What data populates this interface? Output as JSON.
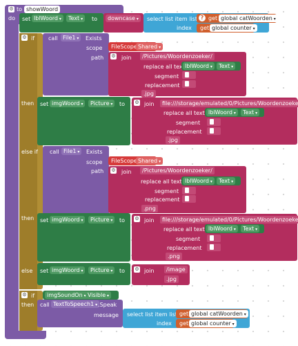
{
  "proc": {
    "to": "to",
    "name": "showWoord",
    "do": "do"
  },
  "set1": {
    "set": "set",
    "comp": "lblWoord",
    "prop": "Text",
    "to": "to",
    "fn": "downcase",
    "select": "select list item  list",
    "get": "get",
    "var1": "global catWoorden",
    "index": "index",
    "var2": "global counter"
  },
  "if1": {
    "if": "if",
    "call": "call",
    "file": "File1",
    "exists": "Exists",
    "scope": "scope",
    "scopeVal": "FileScope",
    "shared": "Shared",
    "path": "path",
    "join": "join",
    "pathStr": "/Pictures/Woordenzoeker/",
    "replace": "replace all text",
    "comp": "lblWoord",
    "prop": "Text",
    "segment": "segment",
    "replacement": "replacement",
    "ext": ".jpg"
  },
  "then1": {
    "then": "then",
    "set": "set",
    "comp": "imgWoord",
    "prop": "Picture",
    "to": "to",
    "join": "join",
    "fileStr": "file:///storage/emulated/0/Pictures/Woordenzoeker/",
    "replace": "replace all text",
    "comp2": "lblWoord",
    "prop2": "Text",
    "segment": "segment",
    "replacement": "replacement",
    "ext": ".jpg"
  },
  "elif": {
    "elseif": "else if",
    "call": "call",
    "file": "File1",
    "exists": "Exists",
    "scope": "scope",
    "scopeVal": "FileScope",
    "shared": "Shared",
    "path": "path",
    "join": "join",
    "pathStr": "/Pictures/Woordenzoeker/",
    "replace": "replace all text",
    "comp": "lblWoord",
    "prop": "Text",
    "segment": "segment",
    "replacement": "replacement",
    "ext": ".png"
  },
  "then2": {
    "then": "then",
    "set": "set",
    "comp": "imgWoord",
    "prop": "Picture",
    "to": "to",
    "join": "join",
    "fileStr": "file:///storage/emulated/0/Pictures/Woordenzoeker/",
    "replace": "replace all text",
    "comp2": "lblWoord",
    "prop2": "Text",
    "segment": "segment",
    "replacement": "replacement",
    "ext": ".png"
  },
  "else": {
    "else": "else",
    "set": "set",
    "comp": "imgWoord",
    "prop": "Picture",
    "to": "to",
    "join": "join",
    "s1": "/image",
    "s2": ".jpg"
  },
  "if2": {
    "if": "if",
    "comp": "imgSoundOn",
    "prop": "Visible",
    "then": "then",
    "call": "call",
    "tts": "TextToSpeech1",
    "speak": ".Speak",
    "message": "message",
    "select": "select list item  list",
    "get": "get",
    "var1": "global catWoorden",
    "index": "index",
    "var2": "global counter"
  }
}
